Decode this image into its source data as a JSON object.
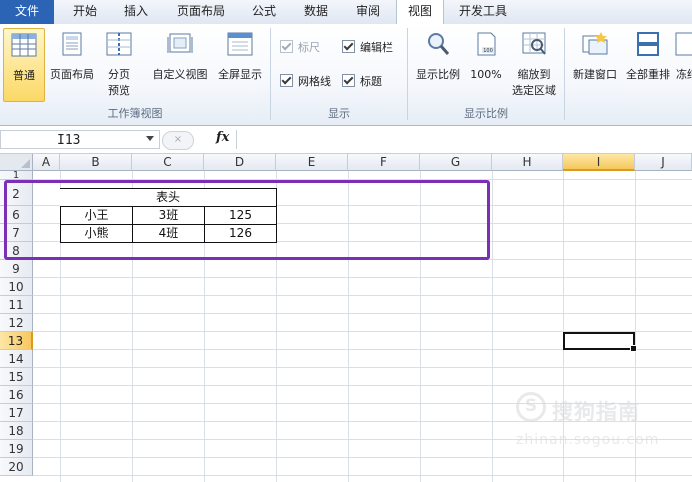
{
  "tabs": [
    "文件",
    "开始",
    "插入",
    "页面布局",
    "公式",
    "数据",
    "审阅",
    "视图",
    "开发工具"
  ],
  "active_tab": "视图",
  "ribbon": {
    "workbook_views": {
      "group_label": "工作簿视图",
      "normal": "普通",
      "page_layout": "页面布局",
      "page_break": "分页\n预览",
      "custom_views": "自定义视图",
      "full_screen": "全屏显示"
    },
    "show": {
      "group_label": "显示",
      "ruler": "标尺",
      "formula_bar": "编辑栏",
      "gridlines": "网格线",
      "headings": "标题"
    },
    "zoom": {
      "group_label": "显示比例",
      "zoom": "显示比例",
      "zoom_100": "100%",
      "zoom_to_selection": "缩放到\n选定区域"
    },
    "window": {
      "new_window": "新建窗口",
      "arrange_all": "全部重排",
      "freeze": "冻结"
    }
  },
  "formula_bar": {
    "name_box": "I13",
    "fx": "fx",
    "cancel": "×",
    "content": ""
  },
  "grid": {
    "columns": [
      "A",
      "B",
      "C",
      "D",
      "E",
      "F",
      "G",
      "H",
      "I",
      "J"
    ],
    "selected_column": "I",
    "rows": [
      "1",
      "2",
      "6",
      "7",
      "8",
      "9",
      "10",
      "11",
      "12",
      "13",
      "14",
      "15",
      "16",
      "17",
      "18",
      "19",
      "20"
    ],
    "selected_row": "13",
    "cells": {
      "header": "表头",
      "r6": [
        "小王",
        "3班",
        "125"
      ],
      "r7": [
        "小熊",
        "4班",
        "126"
      ]
    }
  },
  "colors": {
    "file_tab": "#2b64b5",
    "highlight_box": "#7a2fb6",
    "selected_header": "#f6c85e"
  },
  "watermark": {
    "brand": "搜狗指南",
    "url": "zhinan.sogou.com"
  }
}
